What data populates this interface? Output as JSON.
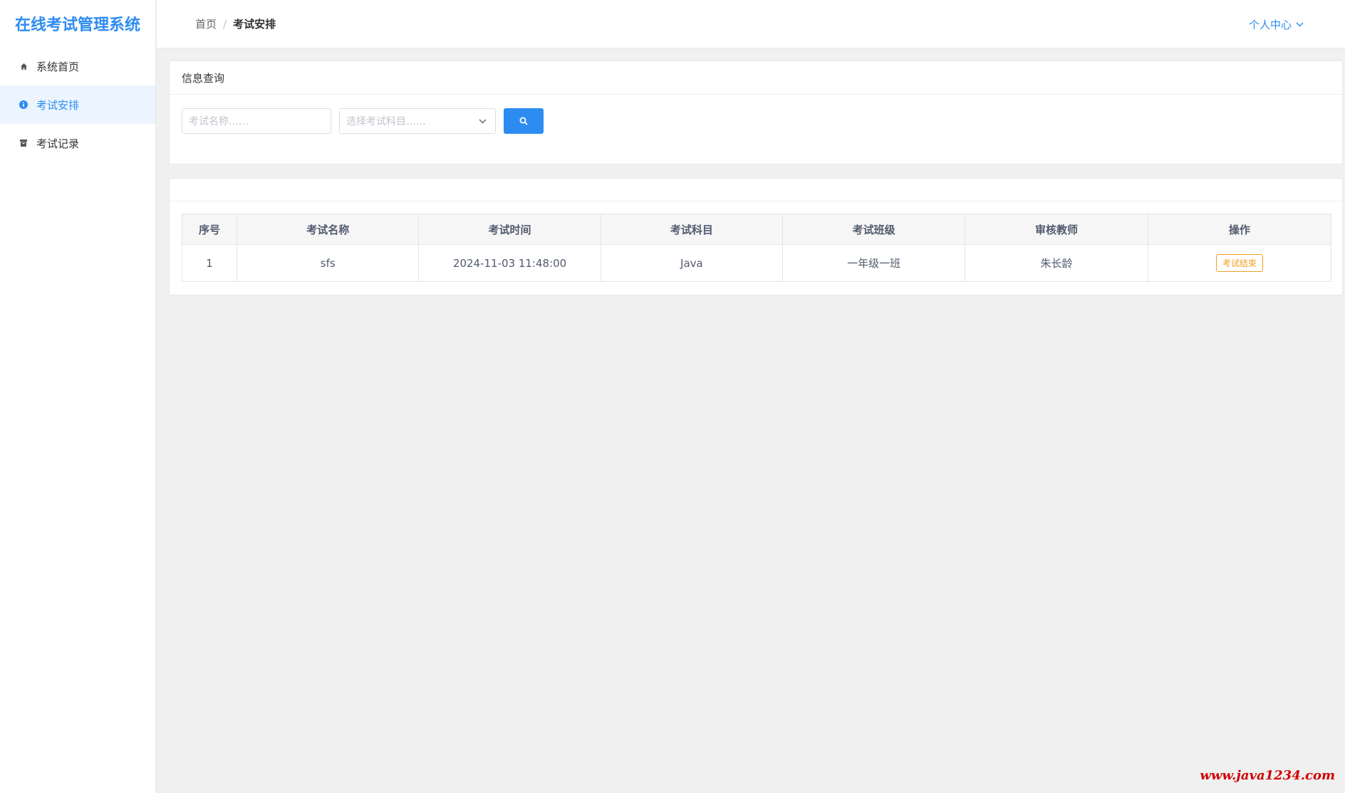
{
  "app": {
    "title": "在线考试管理系统"
  },
  "sidebar": {
    "items": [
      {
        "label": "系统首页",
        "icon": "home-icon"
      },
      {
        "label": "考试安排",
        "icon": "info-circle-icon",
        "active": true
      },
      {
        "label": "考试记录",
        "icon": "archive-icon"
      }
    ]
  },
  "header": {
    "breadcrumb": {
      "home": "首页",
      "separator": "/",
      "current": "考试安排"
    },
    "user_menu": "个人中心"
  },
  "query": {
    "title": "信息查询",
    "name_placeholder": "考试名称……",
    "subject_placeholder": "选择考试科目……",
    "search_icon": "search-icon"
  },
  "table": {
    "columns": [
      "序号",
      "考试名称",
      "考试时间",
      "考试科目",
      "考试班级",
      "审核教师",
      "操作"
    ],
    "rows": [
      {
        "index": "1",
        "name": "sfs",
        "time": "2024-11-03 11:48:00",
        "subject": "Java",
        "class": "一年级一班",
        "teacher": "朱长龄",
        "action": "考试结束"
      }
    ]
  },
  "watermark": "www.java1234.com",
  "colors": {
    "accent": "#2d8cf0",
    "warning": "#f0a020",
    "watermark": "#d00000"
  }
}
